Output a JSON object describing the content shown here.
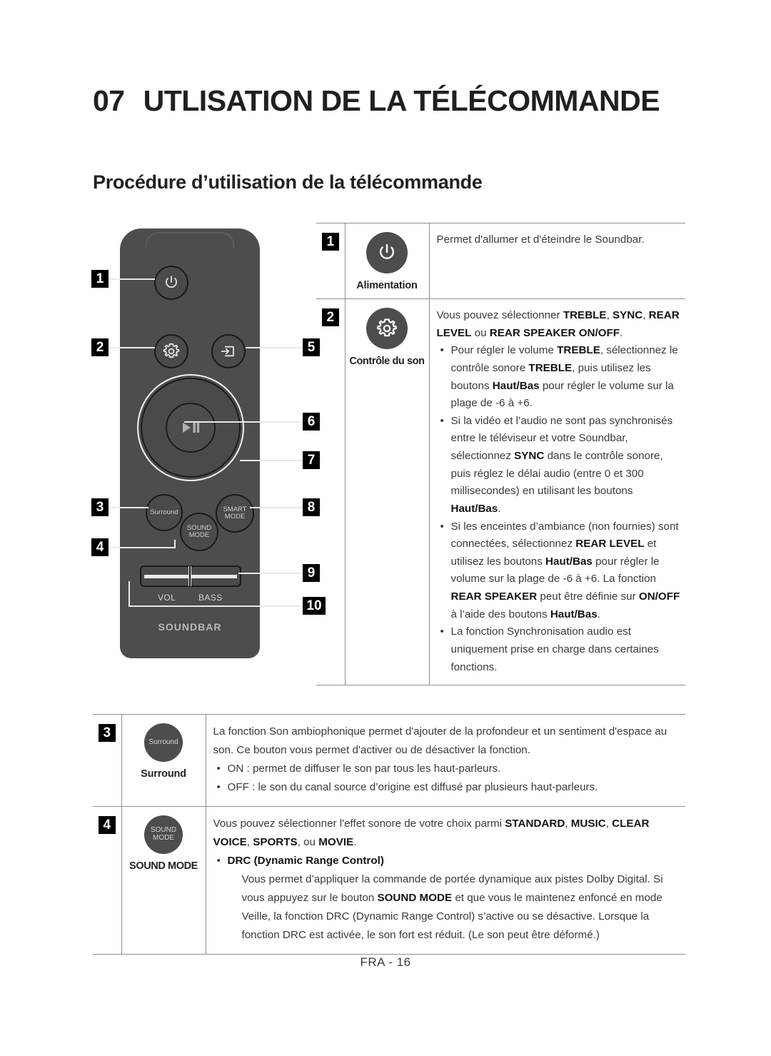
{
  "header": {
    "chapter_number": "07",
    "chapter_title": "UTLISATION DE LA TÉLÉCOMMANDE",
    "section_title": "Procédure d’utilisation de la télécommande"
  },
  "remote": {
    "alt": "soundbar-remote-control",
    "callouts": [
      "1",
      "2",
      "3",
      "4",
      "5",
      "6",
      "7",
      "8",
      "9",
      "10"
    ],
    "buttons": {
      "power_icon": "power-icon",
      "settings_icon": "gear-icon",
      "source_icon": "source-input-icon",
      "play_pause_icon": "play-pause-icon",
      "surround_label": "Surround",
      "sound_mode_label_line1": "SOUND",
      "sound_mode_label_line2": "MODE",
      "smart_mode_label_line1": "SMART",
      "smart_mode_label_line2": "MODE",
      "vol_label": "VOL",
      "bass_label": "BASS",
      "brand_label": "SOUNDBAR"
    }
  },
  "table": {
    "rows": [
      {
        "number": "1",
        "icon": "power-icon",
        "caption": "Alimentation",
        "body": {
          "intro": "Permet d'allumer et d'éteindre le Soundbar.",
          "bullets": []
        }
      },
      {
        "number": "2",
        "icon": "gear-icon",
        "caption": "Contrôle du son",
        "body": {
          "intro_part1": "Vous pouvez sélectionner ",
          "intro_b1": "TREBLE",
          "intro_sep1": ", ",
          "intro_b2": "SYNC",
          "intro_sep2": ", ",
          "intro_b3": "REAR LEVEL",
          "intro_sep3": " ou ",
          "intro_b4": "REAR SPEAKER ON/OFF",
          "intro_end": ".",
          "bullet1": {
            "t1": "Pour régler le volume ",
            "b1": "TREBLE",
            "t2": ", sélectionnez le contrôle sonore ",
            "b2": "TREBLE",
            "t3": ", puis utilisez les boutons ",
            "b3": "Haut/Bas",
            "t4": " pour régler le volume sur la plage de -6 à +6."
          },
          "bullet2": {
            "t1": "Si la vidéo et l’audio ne sont pas synchronisés entre le téléviseur et votre Soundbar, sélectionnez ",
            "b1": "SYNC",
            "t2": " dans le contrôle sonore, puis réglez le délai audio (entre 0 et 300 millisecondes) en utilisant les boutons ",
            "b2": "Haut/Bas",
            "t3": "."
          },
          "bullet3": {
            "t1": "Si les enceintes d’ambiance (non fournies) sont connectées, sélectionnez ",
            "b1": "REAR LEVEL",
            "t2": " et utilisez les boutons ",
            "b2": "Haut/Bas",
            "t3": " pour régler le volume sur la plage de -6 à +6. La fonction ",
            "b3": "REAR SPEAKER",
            "t4": " peut être définie sur ",
            "b4": "ON/OFF",
            "t5": " à l’aide des boutons ",
            "b5": "Haut/Bas",
            "t6": "."
          },
          "bullet4": {
            "t1": "La fonction Synchronisation audio est uniquement prise en charge dans certaines fonctions."
          }
        }
      },
      {
        "number": "3",
        "icon": "surround-button",
        "icon_label": "Surround",
        "caption": "Surround",
        "body": {
          "intro": "La fonction Son ambiophonique permet d'ajouter de la profondeur et un sentiment d'espace au son. Ce bouton vous permet d'activer ou de désactiver la fonction.",
          "bullet1": "ON : permet de diffuser le son par tous les haut-parleurs.",
          "bullet2": "OFF : le son du canal source d’origine est diffusé par plusieurs haut-parleurs."
        }
      },
      {
        "number": "4",
        "icon": "sound-mode-button",
        "icon_label_line1": "SOUND",
        "icon_label_line2": "MODE",
        "caption": "SOUND MODE",
        "body": {
          "intro_t1": "Vous pouvez sélectionner l'effet sonore de votre choix parmi ",
          "intro_b1": "STANDARD",
          "intro_t2": ", ",
          "intro_b2": "MUSIC",
          "intro_t3": ", ",
          "intro_b3": "CLEAR VOICE",
          "intro_t4": ", ",
          "intro_b4": "SPORTS",
          "intro_t5": ", ou ",
          "intro_b5": "MOVIE",
          "intro_t6": ".",
          "bullet_title": "DRC (Dynamic Range Control)",
          "sub_t1": "Vous permet d’appliquer la commande de portée dynamique aux pistes Dolby Digital. Si vous appuyez sur le bouton ",
          "sub_b1": "SOUND MODE",
          "sub_t2": " et que vous le maintenez enfoncé en mode Veille, la fonction DRC (Dynamic Range Control) s’active ou se désactive. Lorsque la fonction DRC est activée, le son fort est réduit. (Le son peut être déformé.)"
        }
      }
    ]
  },
  "footer": {
    "page_label": "FRA - 16"
  },
  "colors": {
    "remote_body": "#4d4d4d",
    "badge_bg": "#000000",
    "table_border": "#8e8e8e",
    "text": "#3a3a3a"
  }
}
